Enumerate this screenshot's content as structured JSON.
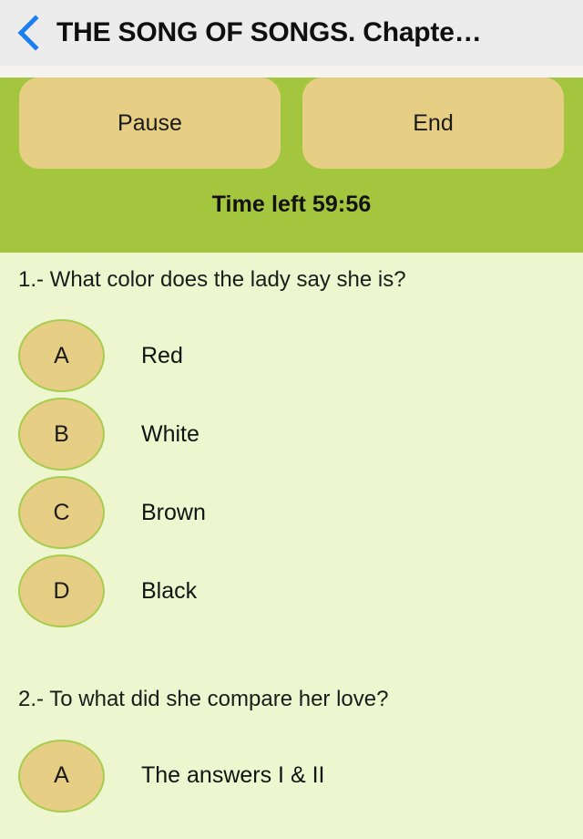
{
  "navbar": {
    "back_icon": "chevron-left-icon",
    "back_accent": "#1a7ff0",
    "title": "THE SONG OF SONGS. Chapte…",
    "background": "#ececec"
  },
  "controls": {
    "pause_label": "Pause",
    "end_label": "End",
    "timer_text": "Time left 59:56",
    "bar_color": "#a4c63f",
    "button_color": "#e6ce84"
  },
  "quiz": {
    "background": "#edf6cf",
    "bubble_fill": "#e6ce84",
    "bubble_border": "#a8cc4f",
    "questions": [
      {
        "text": "1.- What color does the lady say she is?",
        "options": [
          {
            "key": "A",
            "label": "Red"
          },
          {
            "key": "B",
            "label": "White"
          },
          {
            "key": "C",
            "label": "Brown"
          },
          {
            "key": "D",
            "label": "Black"
          }
        ]
      },
      {
        "text": "2.- To what did she compare her love?",
        "options": [
          {
            "key": "A",
            "label": "The answers I & II"
          }
        ]
      }
    ]
  }
}
